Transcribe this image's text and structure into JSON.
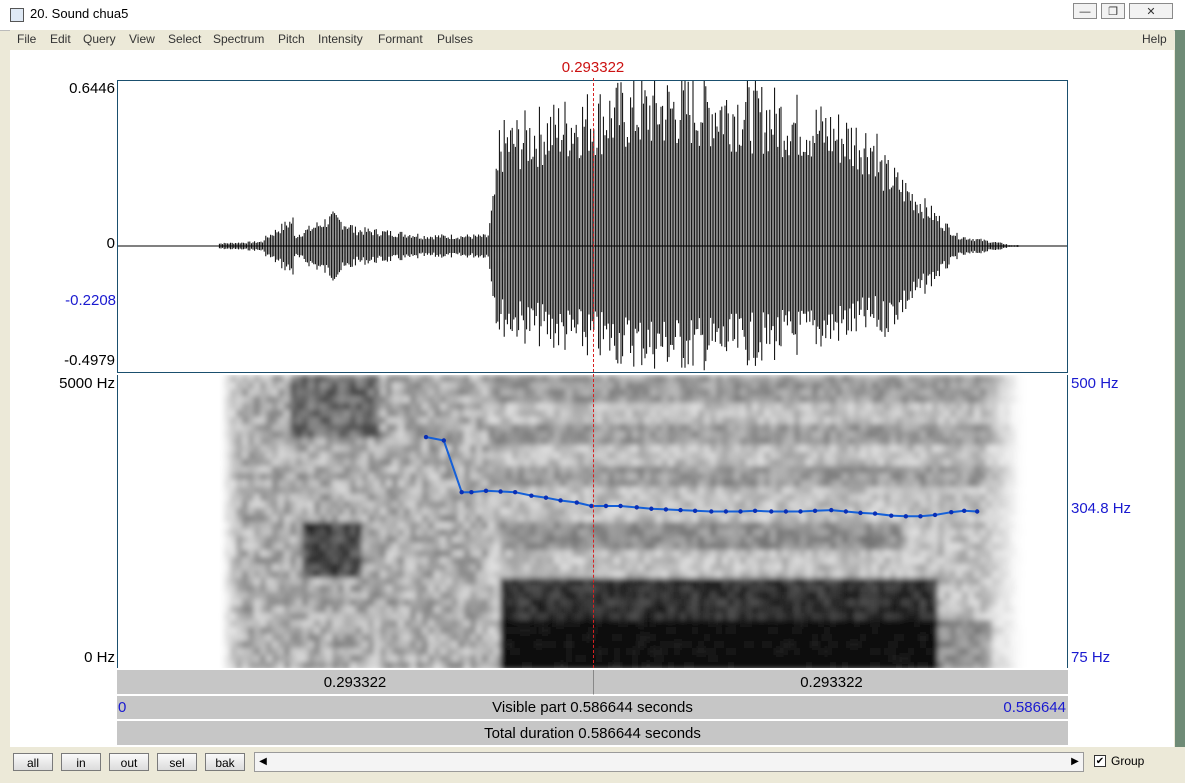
{
  "window": {
    "title": "20. Sound chua5",
    "minimize_glyph": "—",
    "restore_glyph": "❐",
    "close_glyph": "✕"
  },
  "menu": [
    "File",
    "Edit",
    "Query",
    "View",
    "Select",
    "Spectrum",
    "Pitch",
    "Intensity",
    "Formant",
    "Pulses"
  ],
  "menu_help": "Help",
  "cursor_time": "0.293322",
  "waveform": {
    "y_max": "0.6446",
    "y_zero": "0",
    "y_marker": "-0.2208",
    "y_min": "-0.4979"
  },
  "spectrogram": {
    "freq_top": "5000 Hz",
    "freq_bottom": "0 Hz",
    "pitch_top": "500 Hz",
    "pitch_cursor": "304.8 Hz",
    "pitch_bottom": "75 Hz"
  },
  "time_bars": {
    "left_segment": "0.293322",
    "right_segment": "0.293322",
    "visible_start": "0",
    "visible_label": "Visible part 0.586644 seconds",
    "visible_end": "0.586644",
    "total_label": "Total duration 0.586644 seconds"
  },
  "buttons": {
    "all": "all",
    "in": "in",
    "out": "out",
    "sel": "sel",
    "bak": "bak"
  },
  "scroll": {
    "left_arrow": "◀",
    "right_arrow": "▶"
  },
  "group": {
    "label": "Group",
    "checked": "✔"
  },
  "pitch_track": {
    "unit": "Hz",
    "time_s": [
      0.19,
      0.201,
      0.212,
      0.218,
      0.227,
      0.236,
      0.245,
      0.255,
      0.264,
      0.273,
      0.283,
      0.292,
      0.301,
      0.31,
      0.32,
      0.329,
      0.338,
      0.347,
      0.356,
      0.366,
      0.375,
      0.384,
      0.393,
      0.403,
      0.412,
      0.421,
      0.43,
      0.44,
      0.449,
      0.458,
      0.467,
      0.477,
      0.486,
      0.495,
      0.504,
      0.514,
      0.522,
      0.53
    ],
    "f0_hz": [
      410,
      405,
      330,
      330,
      332,
      331,
      330,
      325,
      322,
      318,
      315,
      310,
      310,
      310,
      308,
      306,
      305,
      304,
      303,
      302,
      302,
      302,
      303,
      302,
      302,
      302,
      303,
      304,
      302,
      300,
      299,
      296,
      295,
      295,
      297,
      301,
      303,
      302
    ]
  }
}
